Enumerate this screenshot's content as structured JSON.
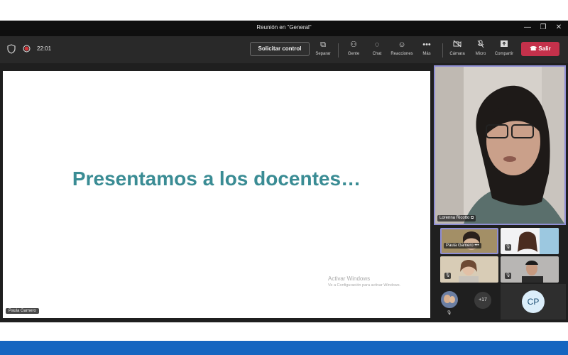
{
  "window": {
    "title": "Reunión en \"General\""
  },
  "toolbar": {
    "timer": "22:01",
    "request_control": "Solicitar control",
    "tools": [
      {
        "label": "Separar",
        "icon": "popout-icon"
      },
      {
        "label": "Gente",
        "icon": "people-icon"
      },
      {
        "label": "Chat",
        "icon": "chat-icon"
      },
      {
        "label": "Reacciones",
        "icon": "reactions-icon"
      },
      {
        "label": "Más",
        "icon": "more-icon"
      },
      {
        "label": "Cámara",
        "icon": "camera-off-icon"
      },
      {
        "label": "Micro",
        "icon": "mic-off-icon"
      },
      {
        "label": "Compartir",
        "icon": "share-icon"
      }
    ],
    "leave": "Salir"
  },
  "stage": {
    "slide_title": "Presentamos a los docentes…",
    "watermark_line1": "Activar Windows",
    "watermark_line2": "Ve a Configuración para activar Windows.",
    "presenter_name": "Paula Gamero"
  },
  "participants": {
    "main_speaker": "Lorenna Ricotto",
    "tile_names": [
      "Paula Gamero"
    ],
    "more_count": "+17",
    "avatar_initials": "CP"
  },
  "colors": {
    "leave": "#c4314b",
    "slide_title": "#3a8c94",
    "active_border": "#8f8ed4",
    "accent_band": "#1565c0"
  }
}
